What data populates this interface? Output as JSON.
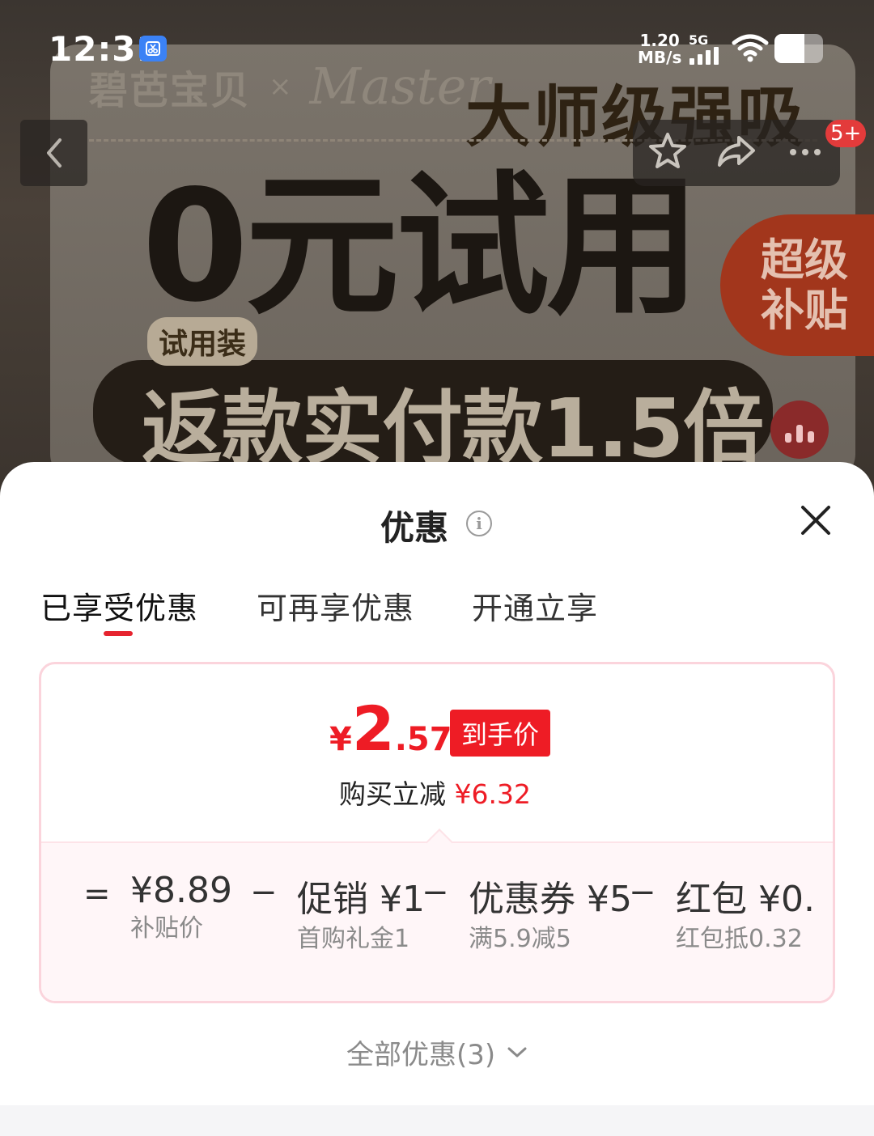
{
  "status_bar": {
    "time": "12:31",
    "net_speed_value": "1.20",
    "net_speed_unit": "MB/s",
    "network_type": "5G",
    "battery_level": 0.62
  },
  "banner": {
    "brand_logo": "碧芭宝贝",
    "brand_cross": "×",
    "brand_master": "Master",
    "headline_top": "大师级强吸",
    "headline_main": "0元试用",
    "trial_tag": "试用装",
    "refund_text": "返款实付款1.5倍",
    "subsidy_line1": "超级",
    "subsidy_line2": "补贴"
  },
  "nav": {
    "back_icon": "chevron-left-icon",
    "favorite_icon": "star-icon",
    "share_icon": "share-icon",
    "more_icon": "more-dots-icon",
    "message_badge": "5+"
  },
  "sheet": {
    "title": "优惠",
    "info_icon_glyph": "i",
    "tabs": [
      {
        "label": "已享受优惠"
      },
      {
        "label": "可再享优惠"
      },
      {
        "label": "开通立享"
      }
    ],
    "price": {
      "symbol": "¥",
      "integer": "2",
      "decimal": ".57",
      "tag": "到手价",
      "save_prefix": "购买立减",
      "save_amount": "¥6.32"
    },
    "breakdown": {
      "equals": "=",
      "minus": "−",
      "items": [
        {
          "value": "¥8.89",
          "label": "补贴价"
        },
        {
          "value": "促销 ¥1",
          "label": "首购礼金1"
        },
        {
          "value": "优惠券 ¥5",
          "label": "满5.9减5"
        },
        {
          "value": "红包 ¥0.",
          "label": "红包抵0.32"
        }
      ]
    },
    "all_offers": "全部优惠(3)"
  },
  "colors": {
    "accent_red": "#ee1c25",
    "tab_underline": "#e6242f",
    "card_border": "#fbd4dc"
  }
}
